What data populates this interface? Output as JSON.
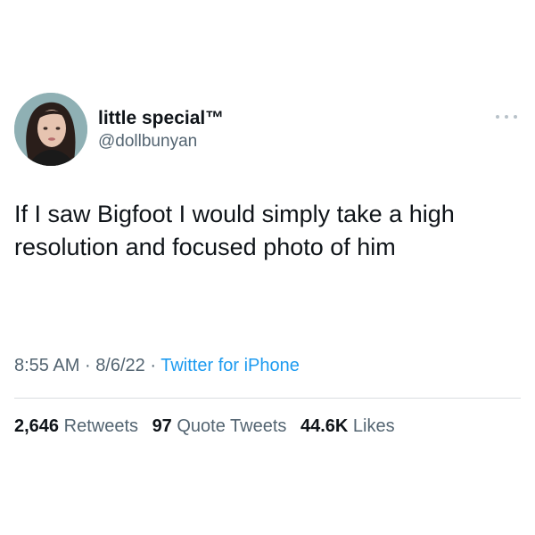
{
  "tweet": {
    "author": {
      "display_name": "little special™",
      "handle": "@dollbunyan"
    },
    "text": "If I saw Bigfoot I would simply take a high resolution and focused photo of him",
    "time": "8:55 AM",
    "separator": "·",
    "date": "8/6/22",
    "source": "Twitter for iPhone",
    "stats": {
      "retweets_count": "2,646",
      "retweets_label": "Retweets",
      "quotes_count": "97",
      "quotes_label": "Quote Tweets",
      "likes_count": "44.6K",
      "likes_label": "Likes"
    }
  },
  "colors": {
    "text_primary": "#0f1419",
    "text_secondary": "#536471",
    "link": "#1d9bf0",
    "divider": "#d9dde0"
  },
  "icons": {
    "more": "more-horizontal-icon"
  }
}
